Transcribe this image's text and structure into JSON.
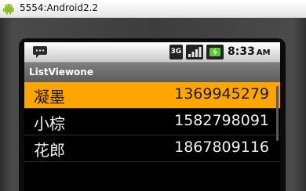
{
  "window": {
    "title": "5554:Android2.2",
    "icon": "android-robot-icon"
  },
  "status_bar": {
    "network": "3G",
    "time": "8:33",
    "ampm": "AM",
    "icons": [
      "notification-icon",
      "3g-icon",
      "signal-icon",
      "battery-icon"
    ]
  },
  "app": {
    "title": "ListViewone"
  },
  "contacts": [
    {
      "name": "凝墨",
      "phone": "1369945279",
      "selected": true
    },
    {
      "name": "小棕",
      "phone": "1582798091",
      "selected": false
    },
    {
      "name": "花郎",
      "phone": "1867809116",
      "selected": false
    }
  ],
  "colors": {
    "selection": "#ffa500",
    "list_background": "#000000",
    "title_bar": "#6b6b6b"
  }
}
